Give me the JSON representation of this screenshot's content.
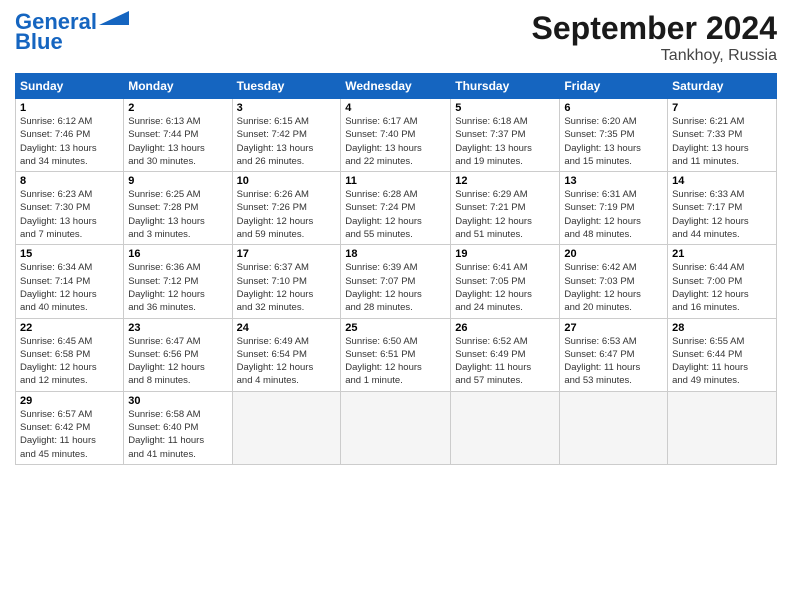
{
  "header": {
    "logo_line1": "General",
    "logo_line2": "Blue",
    "title": "September 2024",
    "subtitle": "Tankhoy, Russia"
  },
  "weekdays": [
    "Sunday",
    "Monday",
    "Tuesday",
    "Wednesday",
    "Thursday",
    "Friday",
    "Saturday"
  ],
  "weeks": [
    [
      {
        "day": "1",
        "info": "Sunrise: 6:12 AM\nSunset: 7:46 PM\nDaylight: 13 hours\nand 34 minutes."
      },
      {
        "day": "2",
        "info": "Sunrise: 6:13 AM\nSunset: 7:44 PM\nDaylight: 13 hours\nand 30 minutes."
      },
      {
        "day": "3",
        "info": "Sunrise: 6:15 AM\nSunset: 7:42 PM\nDaylight: 13 hours\nand 26 minutes."
      },
      {
        "day": "4",
        "info": "Sunrise: 6:17 AM\nSunset: 7:40 PM\nDaylight: 13 hours\nand 22 minutes."
      },
      {
        "day": "5",
        "info": "Sunrise: 6:18 AM\nSunset: 7:37 PM\nDaylight: 13 hours\nand 19 minutes."
      },
      {
        "day": "6",
        "info": "Sunrise: 6:20 AM\nSunset: 7:35 PM\nDaylight: 13 hours\nand 15 minutes."
      },
      {
        "day": "7",
        "info": "Sunrise: 6:21 AM\nSunset: 7:33 PM\nDaylight: 13 hours\nand 11 minutes."
      }
    ],
    [
      {
        "day": "8",
        "info": "Sunrise: 6:23 AM\nSunset: 7:30 PM\nDaylight: 13 hours\nand 7 minutes."
      },
      {
        "day": "9",
        "info": "Sunrise: 6:25 AM\nSunset: 7:28 PM\nDaylight: 13 hours\nand 3 minutes."
      },
      {
        "day": "10",
        "info": "Sunrise: 6:26 AM\nSunset: 7:26 PM\nDaylight: 12 hours\nand 59 minutes."
      },
      {
        "day": "11",
        "info": "Sunrise: 6:28 AM\nSunset: 7:24 PM\nDaylight: 12 hours\nand 55 minutes."
      },
      {
        "day": "12",
        "info": "Sunrise: 6:29 AM\nSunset: 7:21 PM\nDaylight: 12 hours\nand 51 minutes."
      },
      {
        "day": "13",
        "info": "Sunrise: 6:31 AM\nSunset: 7:19 PM\nDaylight: 12 hours\nand 48 minutes."
      },
      {
        "day": "14",
        "info": "Sunrise: 6:33 AM\nSunset: 7:17 PM\nDaylight: 12 hours\nand 44 minutes."
      }
    ],
    [
      {
        "day": "15",
        "info": "Sunrise: 6:34 AM\nSunset: 7:14 PM\nDaylight: 12 hours\nand 40 minutes."
      },
      {
        "day": "16",
        "info": "Sunrise: 6:36 AM\nSunset: 7:12 PM\nDaylight: 12 hours\nand 36 minutes."
      },
      {
        "day": "17",
        "info": "Sunrise: 6:37 AM\nSunset: 7:10 PM\nDaylight: 12 hours\nand 32 minutes."
      },
      {
        "day": "18",
        "info": "Sunrise: 6:39 AM\nSunset: 7:07 PM\nDaylight: 12 hours\nand 28 minutes."
      },
      {
        "day": "19",
        "info": "Sunrise: 6:41 AM\nSunset: 7:05 PM\nDaylight: 12 hours\nand 24 minutes."
      },
      {
        "day": "20",
        "info": "Sunrise: 6:42 AM\nSunset: 7:03 PM\nDaylight: 12 hours\nand 20 minutes."
      },
      {
        "day": "21",
        "info": "Sunrise: 6:44 AM\nSunset: 7:00 PM\nDaylight: 12 hours\nand 16 minutes."
      }
    ],
    [
      {
        "day": "22",
        "info": "Sunrise: 6:45 AM\nSunset: 6:58 PM\nDaylight: 12 hours\nand 12 minutes."
      },
      {
        "day": "23",
        "info": "Sunrise: 6:47 AM\nSunset: 6:56 PM\nDaylight: 12 hours\nand 8 minutes."
      },
      {
        "day": "24",
        "info": "Sunrise: 6:49 AM\nSunset: 6:54 PM\nDaylight: 12 hours\nand 4 minutes."
      },
      {
        "day": "25",
        "info": "Sunrise: 6:50 AM\nSunset: 6:51 PM\nDaylight: 12 hours\nand 1 minute."
      },
      {
        "day": "26",
        "info": "Sunrise: 6:52 AM\nSunset: 6:49 PM\nDaylight: 11 hours\nand 57 minutes."
      },
      {
        "day": "27",
        "info": "Sunrise: 6:53 AM\nSunset: 6:47 PM\nDaylight: 11 hours\nand 53 minutes."
      },
      {
        "day": "28",
        "info": "Sunrise: 6:55 AM\nSunset: 6:44 PM\nDaylight: 11 hours\nand 49 minutes."
      }
    ],
    [
      {
        "day": "29",
        "info": "Sunrise: 6:57 AM\nSunset: 6:42 PM\nDaylight: 11 hours\nand 45 minutes."
      },
      {
        "day": "30",
        "info": "Sunrise: 6:58 AM\nSunset: 6:40 PM\nDaylight: 11 hours\nand 41 minutes."
      },
      {
        "day": "",
        "info": ""
      },
      {
        "day": "",
        "info": ""
      },
      {
        "day": "",
        "info": ""
      },
      {
        "day": "",
        "info": ""
      },
      {
        "day": "",
        "info": ""
      }
    ]
  ]
}
